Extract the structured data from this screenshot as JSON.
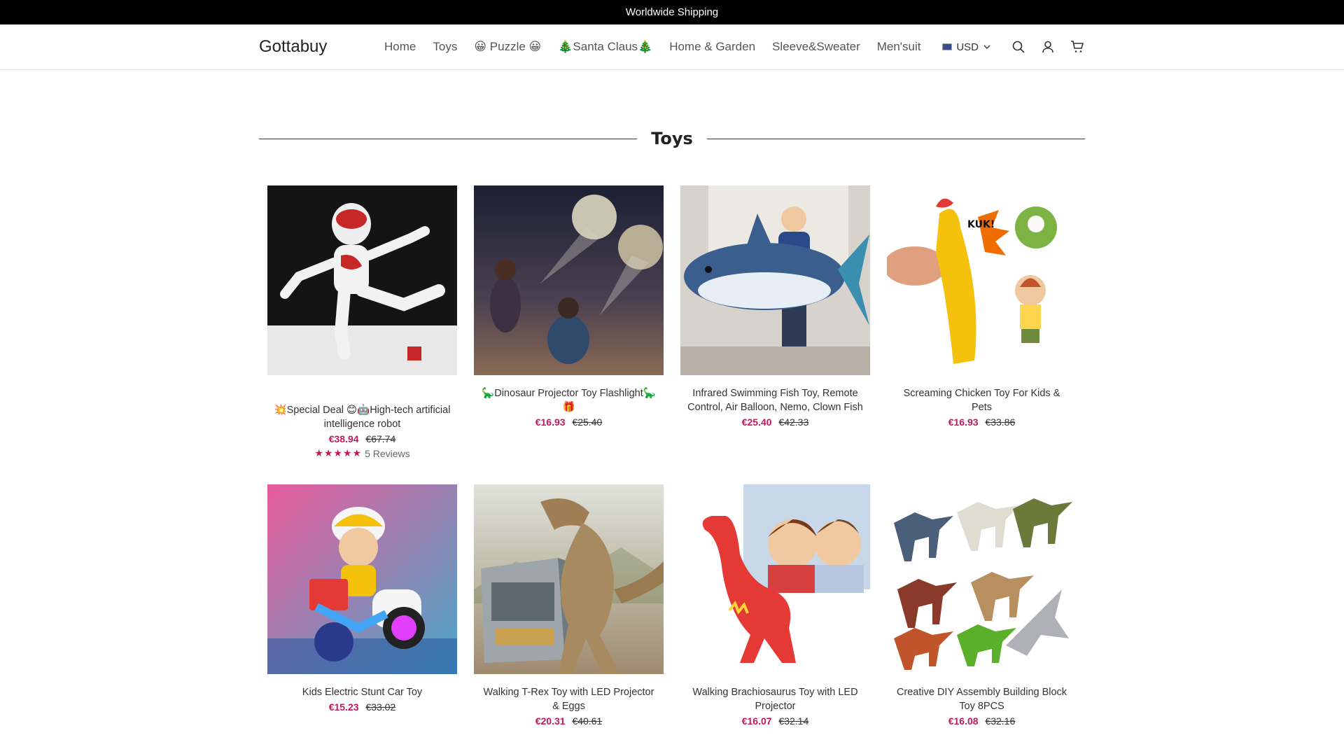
{
  "announcement": "Worldwide Shipping",
  "brand": "Gottabuy",
  "nav": [
    "Home",
    "Toys",
    "😀 Puzzle 😀",
    "🎄Santa Claus🎄",
    "Home & Garden",
    "Sleeve&Sweater",
    "Men'suit"
  ],
  "currency": "USD",
  "icons": [
    "flag-icon",
    "chevron-down-icon",
    "search-icon",
    "account-icon",
    "cart-icon"
  ],
  "section_title": "Toys",
  "accent_color": "#c2185b",
  "products": [
    {
      "title": "💥Special Deal 😊🤖High-tech artificial intelligence robot",
      "price": "€38.94",
      "compare": "€67.74",
      "rating": "★★★★★",
      "reviews": "5 Reviews"
    },
    {
      "title": "🦕Dinosaur Projector Toy Flashlight🦕🎁",
      "price": "€16.93",
      "compare": "€25.40"
    },
    {
      "title": "Infrared Swimming Fish Toy, Remote Control, Air Balloon, Nemo, Clown Fish",
      "price": "€25.40",
      "compare": "€42.33"
    },
    {
      "title": "Screaming Chicken Toy For Kids & Pets",
      "price": "€16.93",
      "compare": "€33.86"
    },
    {
      "title": "Kids Electric Stunt Car Toy",
      "price": "€15.23",
      "compare": "€33.02"
    },
    {
      "title": "Walking T-Rex Toy with LED Projector & Eggs",
      "price": "€20.31",
      "compare": "€40.61"
    },
    {
      "title": "Walking Brachiosaurus Toy with LED Projector",
      "price": "€16.07",
      "compare": "€32.14"
    },
    {
      "title": "Creative DIY Assembly Building Block Toy 8PCS",
      "price": "€16.08",
      "compare": "€32.16"
    }
  ]
}
